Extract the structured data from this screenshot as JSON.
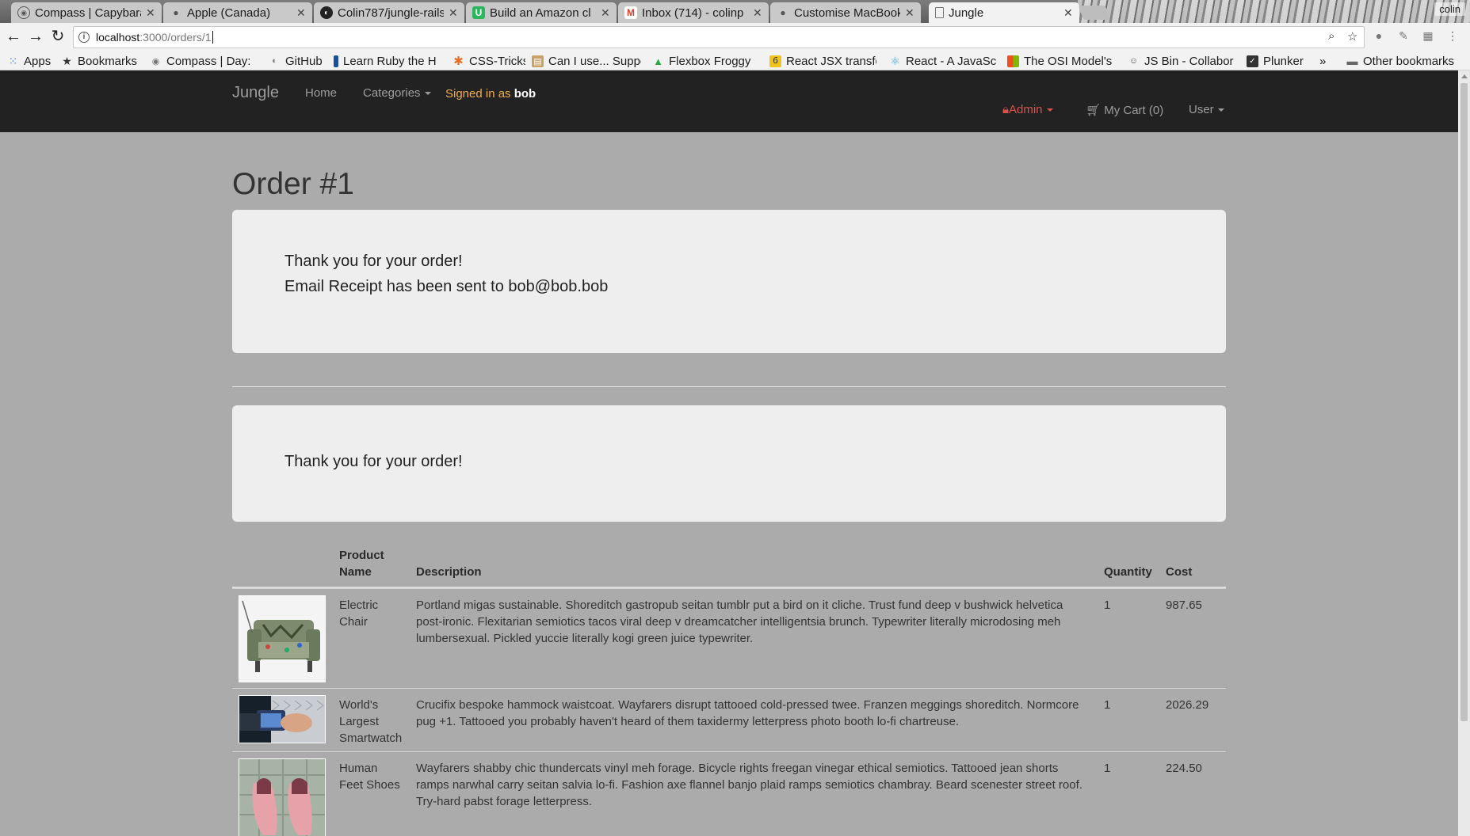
{
  "browser": {
    "tabs": [
      {
        "title": "Compass | Capybara",
        "favicon": "compass-icon"
      },
      {
        "title": "Apple (Canada)",
        "favicon": "apple-icon"
      },
      {
        "title": "Colin787/jungle-rails",
        "favicon": "github-icon"
      },
      {
        "title": "Build an Amazon cl",
        "favicon": "udemy-icon"
      },
      {
        "title": "Inbox (714) - colinp",
        "favicon": "gmail-icon"
      },
      {
        "title": "Customise MacBook",
        "favicon": "apple-icon"
      },
      {
        "title": "Jungle",
        "favicon": "page-icon"
      }
    ],
    "active_tab": 6,
    "profile_name": "colin",
    "url_host": "localhost",
    "url_path": ":3000/orders/1",
    "bookmarks": [
      {
        "label": "Apps",
        "icon": "apps-grid-icon",
        "color": "#4285f4"
      },
      {
        "label": "Bookmarks",
        "icon": "star-icon",
        "color": "#333333"
      },
      {
        "label": "Compass | Day: w",
        "icon": "compass-icon",
        "color": "#777777"
      },
      {
        "label": "GitHub",
        "icon": "github-icon",
        "color": "#777777"
      },
      {
        "label": "Learn Ruby the H",
        "icon": "ruby-icon",
        "color": "#1a4fa0"
      },
      {
        "label": "CSS-Tricks",
        "icon": "css-tricks-icon",
        "color": "#e76e27"
      },
      {
        "label": "Can I use... Suppo",
        "icon": "caniuse-icon",
        "color": "#8e5c2a"
      },
      {
        "label": "Flexbox Froggy",
        "icon": "frog-icon",
        "color": "#2aa845"
      },
      {
        "label": "React JSX transfo",
        "icon": "babel-icon",
        "color": "#f0c419"
      },
      {
        "label": "React - A JavaScr",
        "icon": "react-icon",
        "color": "#3fa9d6"
      },
      {
        "label": "The OSI Model's",
        "icon": "microsoft-icon",
        "color": "#e4482b"
      },
      {
        "label": "JS Bin - Collabor",
        "icon": "jsbin-icon",
        "color": "#555555"
      },
      {
        "label": "Plunker",
        "icon": "plunker-icon",
        "color": "#333333"
      },
      {
        "label": "»",
        "icon": "overflow-chevron-icon",
        "color": "#333333"
      },
      {
        "label": "Other bookmarks",
        "icon": "folder-icon",
        "color": "#666666"
      }
    ]
  },
  "navbar": {
    "brand": "Jungle",
    "home": "Home",
    "categories": "Categories",
    "signed_in_prefix": "Signed in as ",
    "signed_in_user": "bob",
    "admin": "Admin",
    "cart": "My Cart (0)",
    "user": "User"
  },
  "order": {
    "title": "Order #1",
    "thanks": "Thank you for your order!",
    "email_receipt": "Email Receipt has been sent to bob@bob.bob",
    "thanks_again": "Thank you for your order!"
  },
  "table": {
    "headers": {
      "name_line1": "Product",
      "name_line2": "Name",
      "description": "Description",
      "quantity": "Quantity",
      "cost": "Cost"
    },
    "rows": [
      {
        "image": "electric-chair-image",
        "name": "Electric Chair",
        "description": "Portland migas sustainable. Shoreditch gastropub seitan tumblr put a bird on it cliche. Trust fund deep v bushwick helvetica post-ironic. Flexitarian semiotics tacos viral deep v dreamcatcher intelligentsia brunch. Typewriter literally microdosing meh lumbersexual. Pickled yuccie literally kogi green juice typewriter.",
        "quantity": "1",
        "cost": "987.65"
      },
      {
        "image": "smartwatch-image",
        "name": "World's Largest Smartwatch",
        "description": "Crucifix bespoke hammock waistcoat. Wayfarers disrupt tattooed cold-pressed twee. Franzen meggings shoreditch. Normcore pug +1. Tattooed you probably haven't heard of them taxidermy letterpress photo booth lo-fi chartreuse.",
        "quantity": "1",
        "cost": "2026.29"
      },
      {
        "image": "feet-shoes-image",
        "name": "Human Feet Shoes",
        "description": "Wayfarers shabby chic thundercats vinyl meh forage. Bicycle rights freegan vinegar ethical semiotics. Tattooed jean shorts ramps narwhal carry seitan salvia lo-fi. Fashion axe flannel banjo plaid ramps semiotics chambray. Beard scenester street roof. Try-hard pabst forage letterpress.",
        "quantity": "1",
        "cost": "224.50"
      }
    ]
  }
}
